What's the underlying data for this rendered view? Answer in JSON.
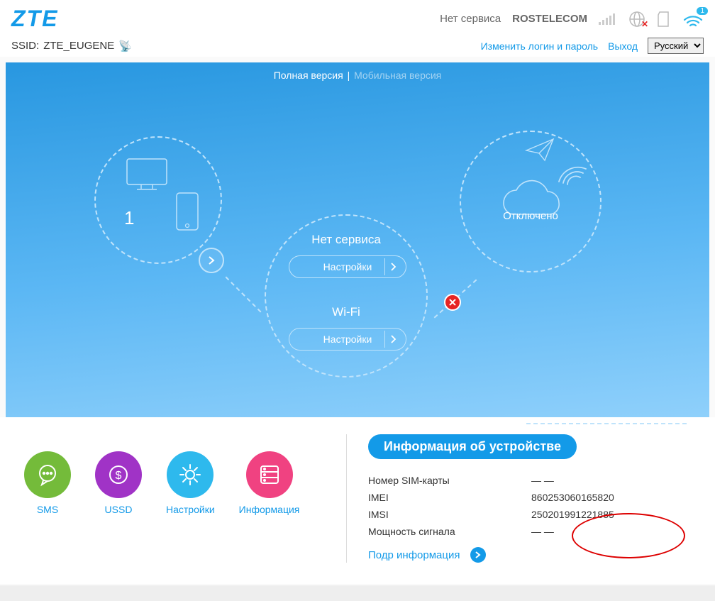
{
  "header": {
    "logo": "ZTE",
    "service_status": "Нет сервиса",
    "operator": "ROSTELECOM",
    "wifi_badge": "1",
    "ssid_prefix": "SSID:",
    "ssid": "ZTE_EUGENE",
    "change_login_link": "Изменить логин и пароль",
    "logout_link": "Выход",
    "language": "Русский"
  },
  "hero": {
    "full_version": "Полная версия",
    "mobile_version": "Мобильная версия",
    "sep": " | ",
    "devices_count": "1",
    "mid_top_label": "Нет сервиса",
    "mid_bot_label": "Wi-Fi",
    "settings_btn": "Настройки",
    "right_label": "Отключено"
  },
  "apps": {
    "sms": "SMS",
    "ussd": "USSD",
    "settings": "Настройки",
    "info": "Информация"
  },
  "device_info": {
    "title": "Информация об устройстве",
    "rows": [
      {
        "k": "Номер SIM-карты",
        "v": "— —"
      },
      {
        "k": "IMEI",
        "v": "860253060165820"
      },
      {
        "k": "IMSI",
        "v": "250201991221885"
      },
      {
        "k": "Мощность сигнала",
        "v": "— —"
      }
    ],
    "more": "Подр информация"
  }
}
